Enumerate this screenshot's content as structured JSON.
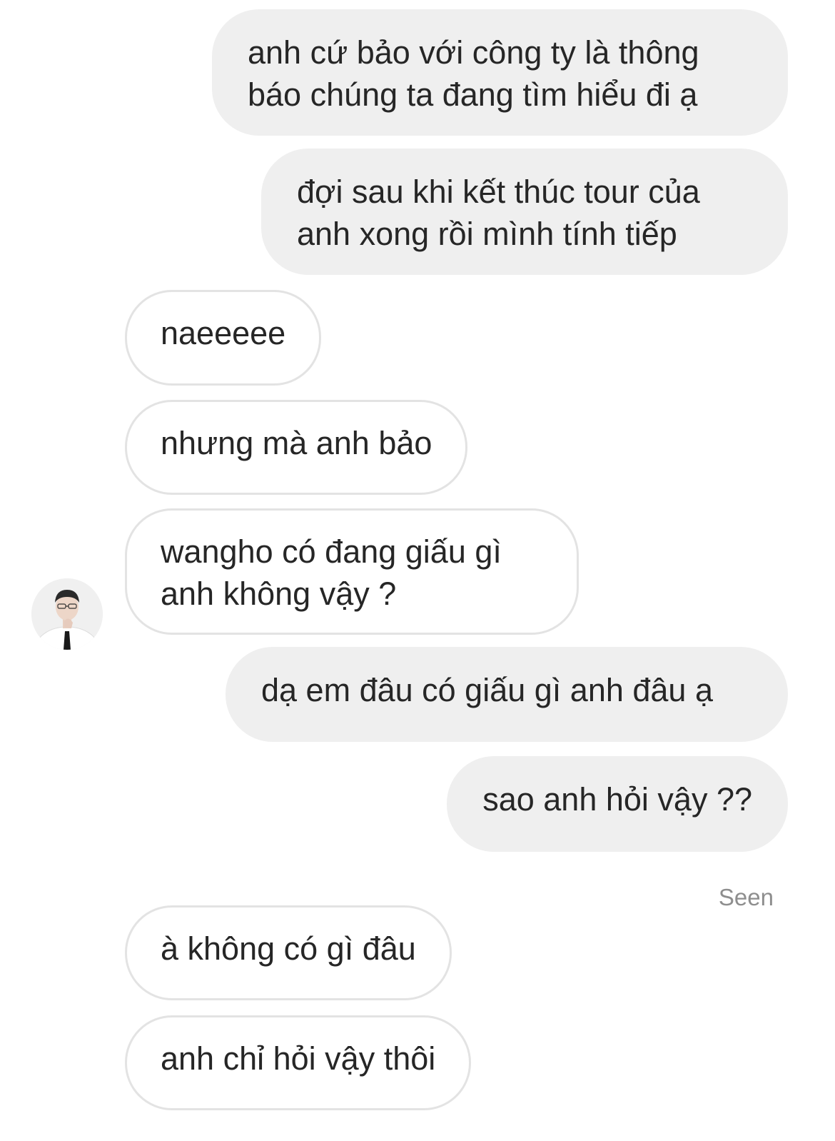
{
  "messages": [
    {
      "dir": "out",
      "line1": "anh cứ bảo với công ty là thông",
      "line2": "báo chúng ta đang tìm hiểu đi ạ"
    },
    {
      "dir": "out",
      "line1": "đợi sau khi kết thúc tour của",
      "line2": "anh xong rồi mình tính tiếp"
    },
    {
      "dir": "in",
      "text": "naeeeee"
    },
    {
      "dir": "in",
      "text": "nhưng mà anh bảo"
    },
    {
      "dir": "in",
      "line1": "wangho có đang giấu gì",
      "line2": "anh không vậy ?"
    },
    {
      "dir": "out",
      "text": "dạ em đâu có giấu gì anh đâu ạ"
    },
    {
      "dir": "out",
      "text": "sao anh hỏi vậy ??"
    },
    {
      "dir": "in",
      "text": "à không có gì đâu"
    },
    {
      "dir": "in",
      "text": "anh chỉ hỏi vậy thôi"
    }
  ],
  "status": {
    "seen": "Seen"
  },
  "colors": {
    "outgoing_bubble": "#efefef",
    "incoming_border": "#e3e3e3",
    "text": "#262626",
    "seen_text": "#8e8e8e"
  },
  "icons": {
    "avatar": "user-avatar-photo"
  }
}
